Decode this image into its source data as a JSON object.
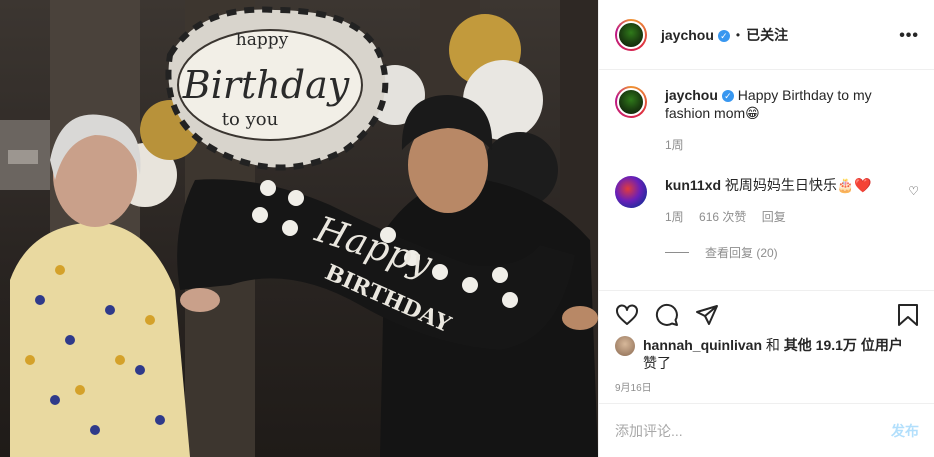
{
  "post": {
    "author": "jaychou",
    "follow_state": "已关注",
    "more_icon": "more-icon",
    "photo_text": {
      "balloon_top_line1": "happy",
      "balloon_top_line2": "Birthday",
      "balloon_top_line3": "to you",
      "banner_line1": "Happy",
      "banner_line2": "BIRTHDAY"
    }
  },
  "comments": [
    {
      "user": "jaychou",
      "text": "Happy Birthday to my fashion mom😁",
      "time": "1周"
    },
    {
      "user": "kun11xd",
      "text": "祝周妈妈生日快乐🎂❤️",
      "time": "1周",
      "likes": "616 次赞",
      "reply": "回复",
      "view_replies": "查看回复 (20)"
    }
  ],
  "likes": {
    "user": "hannah_quinlivan",
    "and": "和",
    "others": "其他 19.1万 位用户",
    "suffix": "赞了"
  },
  "date": "9月16日",
  "add_comment": {
    "placeholder": "添加评论...",
    "post_label": "发布"
  },
  "colors": {
    "link_blue": "#3897f0",
    "post_disabled": "#b2dffc",
    "meta_gray": "#8e8e8e"
  }
}
